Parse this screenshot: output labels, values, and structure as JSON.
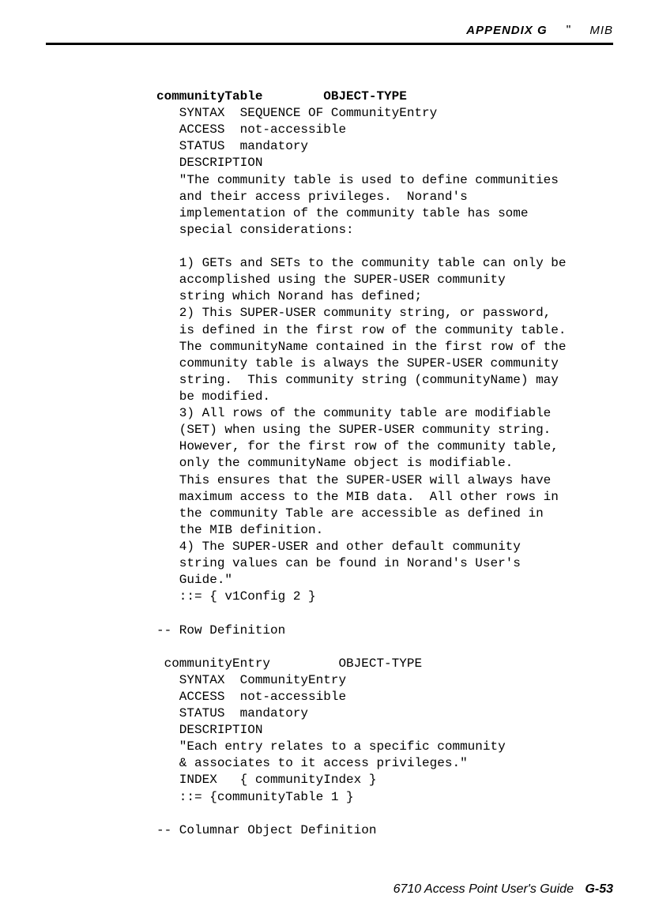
{
  "header": {
    "appendix": "APPENDIX G",
    "separator": "\"",
    "mib": "MIB"
  },
  "def1": {
    "title_bold": "communityTable        OBJECT-TYPE",
    "body": "   SYNTAX  SEQUENCE OF CommunityEntry\n   ACCESS  not-accessible\n   STATUS  mandatory\n   DESCRIPTION\n   \"The community table is used to define communities\n   and their access privileges.  Norand's\n   implementation of the community table has some\n   special considerations:\n\n   1) GETs and SETs to the community table can only be\n   accomplished using the SUPER-USER community\n   string which Norand has defined;\n   2) This SUPER-USER community string, or password,\n   is defined in the first row of the community table.\n   The communityName contained in the first row of the\n   community table is always the SUPER-USER community\n   string.  This community string (communityName) may\n   be modified.\n   3) All rows of the community table are modifiable\n   (SET) when using the SUPER-USER community string.\n   However, for the first row of the community table,\n   only the communityName object is modifiable.\n   This ensures that the SUPER-USER will always have\n   maximum access to the MIB data.  All other rows in\n   the community Table are accessible as defined in\n   the MIB definition.\n   4) The SUPER-USER and other default community\n   string values can be found in Norand's User's\n   Guide.\"\n   ::= { v1Config 2 }"
  },
  "rowdef_comment": "-- Row Definition",
  "def2": {
    "title": " communityEntry         OBJECT-TYPE",
    "body": "   SYNTAX  CommunityEntry\n   ACCESS  not-accessible\n   STATUS  mandatory\n   DESCRIPTION\n   \"Each entry relates to a specific community\n   & associates to it access privileges.\"\n   INDEX   { communityIndex }\n   ::= {communityTable 1 }"
  },
  "col_comment": "-- Columnar Object Definition",
  "footer": {
    "guide": "6710 Access Point User's Guide",
    "page": "G-53"
  }
}
